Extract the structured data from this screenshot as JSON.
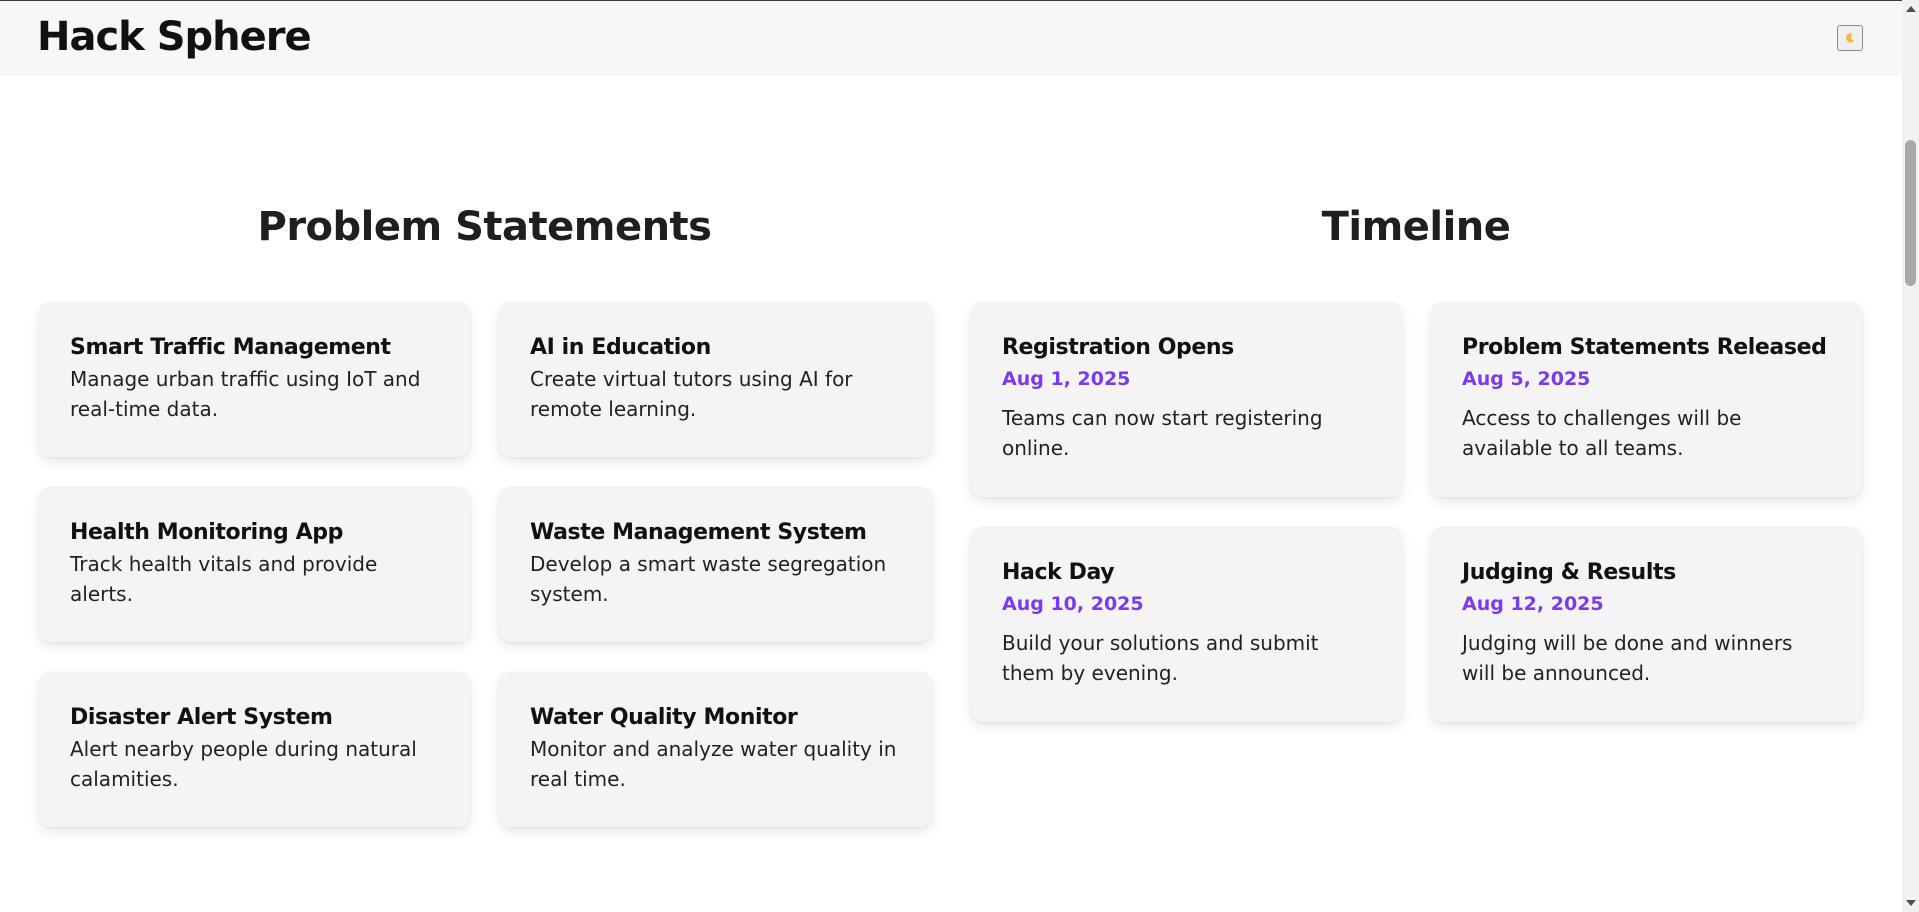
{
  "header": {
    "brand": "Hack Sphere",
    "theme_toggle_icon": "moon-icon"
  },
  "problems": {
    "title": "Problem Statements",
    "items": [
      {
        "title": "Smart Traffic Management",
        "desc": "Manage urban traffic using IoT and real-time data."
      },
      {
        "title": "AI in Education",
        "desc": "Create virtual tutors using AI for remote learning."
      },
      {
        "title": "Health Monitoring App",
        "desc": "Track health vitals and provide alerts."
      },
      {
        "title": "Waste Management System",
        "desc": "Develop a smart waste segregation system."
      },
      {
        "title": "Disaster Alert System",
        "desc": "Alert nearby people during natural calamities."
      },
      {
        "title": "Water Quality Monitor",
        "desc": "Monitor and analyze water quality in real time."
      }
    ]
  },
  "timeline": {
    "title": "Timeline",
    "items": [
      {
        "title": "Registration Opens",
        "date": "Aug 1, 2025",
        "desc": "Teams can now start registering online."
      },
      {
        "title": "Problem Statements Released",
        "date": "Aug 5, 2025",
        "desc": "Access to challenges will be available to all teams."
      },
      {
        "title": "Hack Day",
        "date": "Aug 10, 2025",
        "desc": "Build your solutions and submit them by evening."
      },
      {
        "title": "Judging & Results",
        "date": "Aug 12, 2025",
        "desc": "Judging will be done and winners will be announced."
      }
    ]
  },
  "colors": {
    "accent": "#7c3aed",
    "card_bg": "#f4f4f4",
    "header_bg": "#f6f7f9"
  }
}
